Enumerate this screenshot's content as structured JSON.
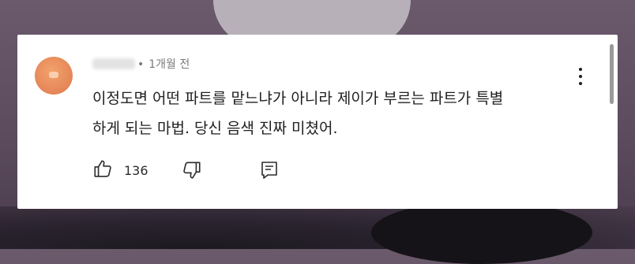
{
  "comment": {
    "timestamp": "1개월 전",
    "separator": "•",
    "text_line1": "이정도면 어떤 파트를 맡느냐가 아니라 제이가 부르는 파트가 특별",
    "text_line2": "하게 되는 마법. 당신 음색 진짜 미쳤어.",
    "likes": "136"
  },
  "icons": {
    "like": "thumbs-up-icon",
    "dislike": "thumbs-down-icon",
    "reply": "reply-comment-icon",
    "more": "more-vertical-icon"
  },
  "colors": {
    "card_background": "#ffffff",
    "avatar": "#e7895a",
    "text": "#1f1f1f",
    "meta_text": "#7a7a7a"
  }
}
